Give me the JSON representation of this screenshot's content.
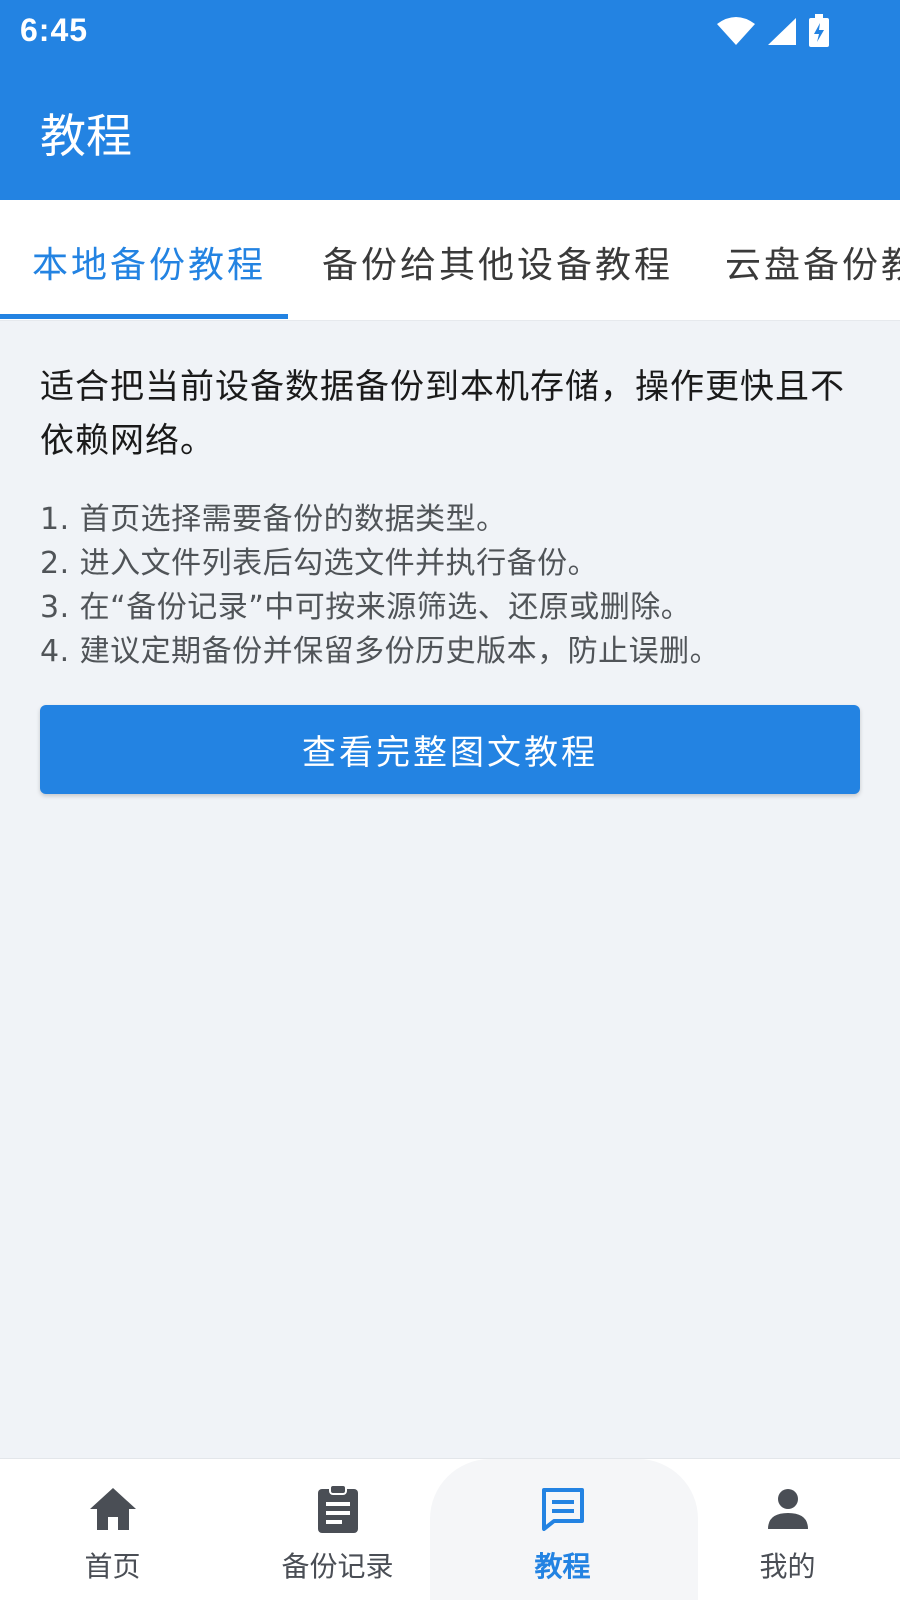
{
  "status_bar": {
    "time": "6:45",
    "icons": [
      "wifi-icon",
      "signal-icon",
      "battery-charging-icon"
    ]
  },
  "app_bar": {
    "title": "教程"
  },
  "tabs": [
    {
      "label": "本地备份教程",
      "active": true
    },
    {
      "label": "备份给其他设备教程",
      "active": false
    },
    {
      "label": "云盘备份教程",
      "active": false
    }
  ],
  "content": {
    "intro": "适合把当前设备数据备份到本机存储，操作更快且不依赖网络。",
    "steps": [
      "1. 首页选择需要备份的数据类型。",
      "2. 进入文件列表后勾选文件并执行备份。",
      "3. 在“备份记录”中可按来源筛选、还原或删除。",
      "4. 建议定期备份并保留多份历史版本，防止误删。"
    ],
    "cta_label": "查看完整图文教程"
  },
  "bottom_nav": [
    {
      "label": "首页",
      "icon": "home-icon",
      "active": false
    },
    {
      "label": "备份记录",
      "icon": "clipboard-icon",
      "active": false
    },
    {
      "label": "教程",
      "icon": "tutorial-icon",
      "active": true
    },
    {
      "label": "我的",
      "icon": "person-icon",
      "active": false
    }
  ],
  "colors": {
    "primary": "#2383E2",
    "background": "#F0F3F7",
    "nav_inactive": "#4A4E55"
  }
}
